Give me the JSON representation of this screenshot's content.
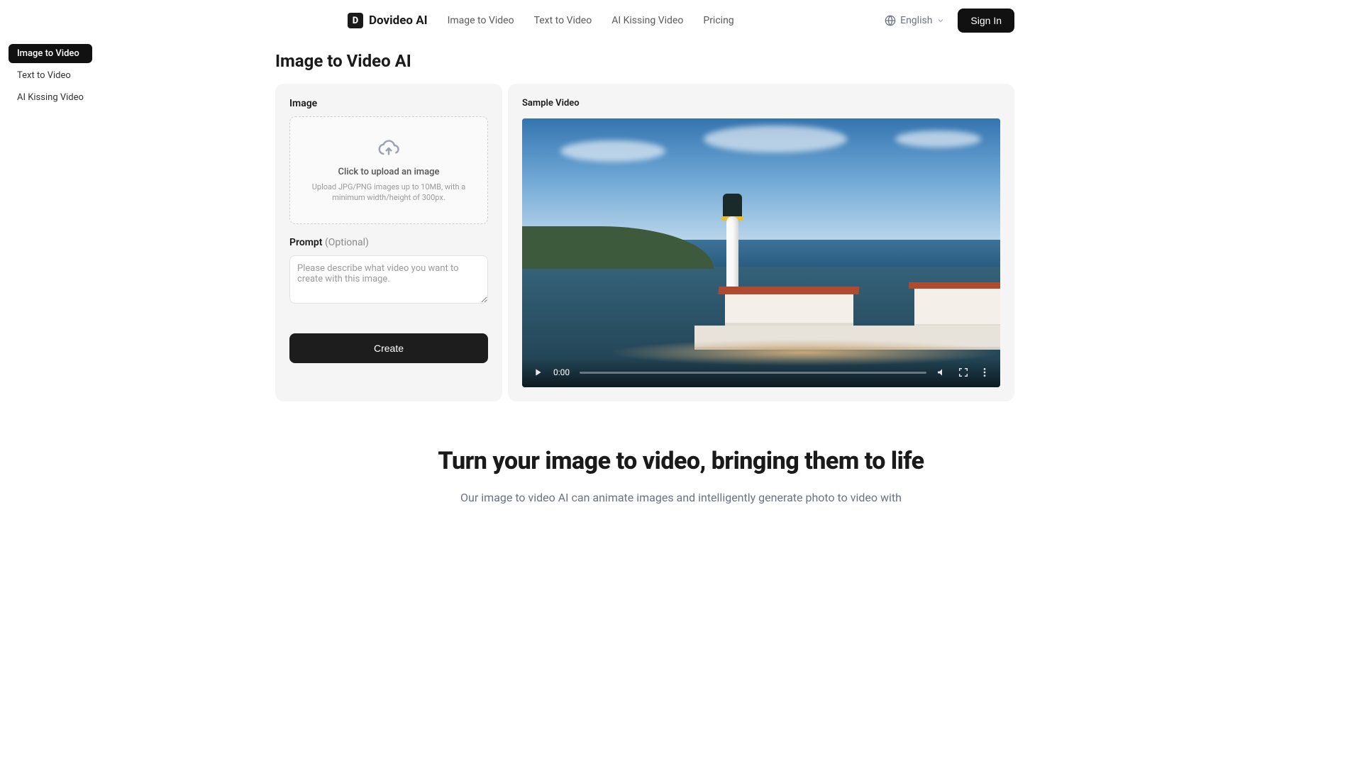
{
  "header": {
    "brand": "Dovideo AI",
    "nav": [
      "Image to Video",
      "Text to Video",
      "AI Kissing Video",
      "Pricing"
    ],
    "language": "English",
    "signin": "Sign In"
  },
  "sidebar": {
    "tabs": [
      "Image to Video",
      "Text to Video",
      "AI Kissing Video"
    ],
    "active_index": 0
  },
  "page": {
    "title": "Image to Video AI"
  },
  "form": {
    "image_label": "Image",
    "upload_title": "Click to upload an image",
    "upload_sub": "Upload JPG/PNG images up to 10MB, with a minimum width/height of 300px.",
    "prompt_label": "Prompt",
    "prompt_optional": "(Optional)",
    "prompt_placeholder": "Please describe what video you want to create with this image.",
    "create_label": "Create"
  },
  "sample": {
    "label": "Sample Video",
    "time": "0:00"
  },
  "hero": {
    "title": "Turn your image to video, bringing them to life",
    "sub": "Our image to video AI can animate images and intelligently generate photo to video with"
  }
}
